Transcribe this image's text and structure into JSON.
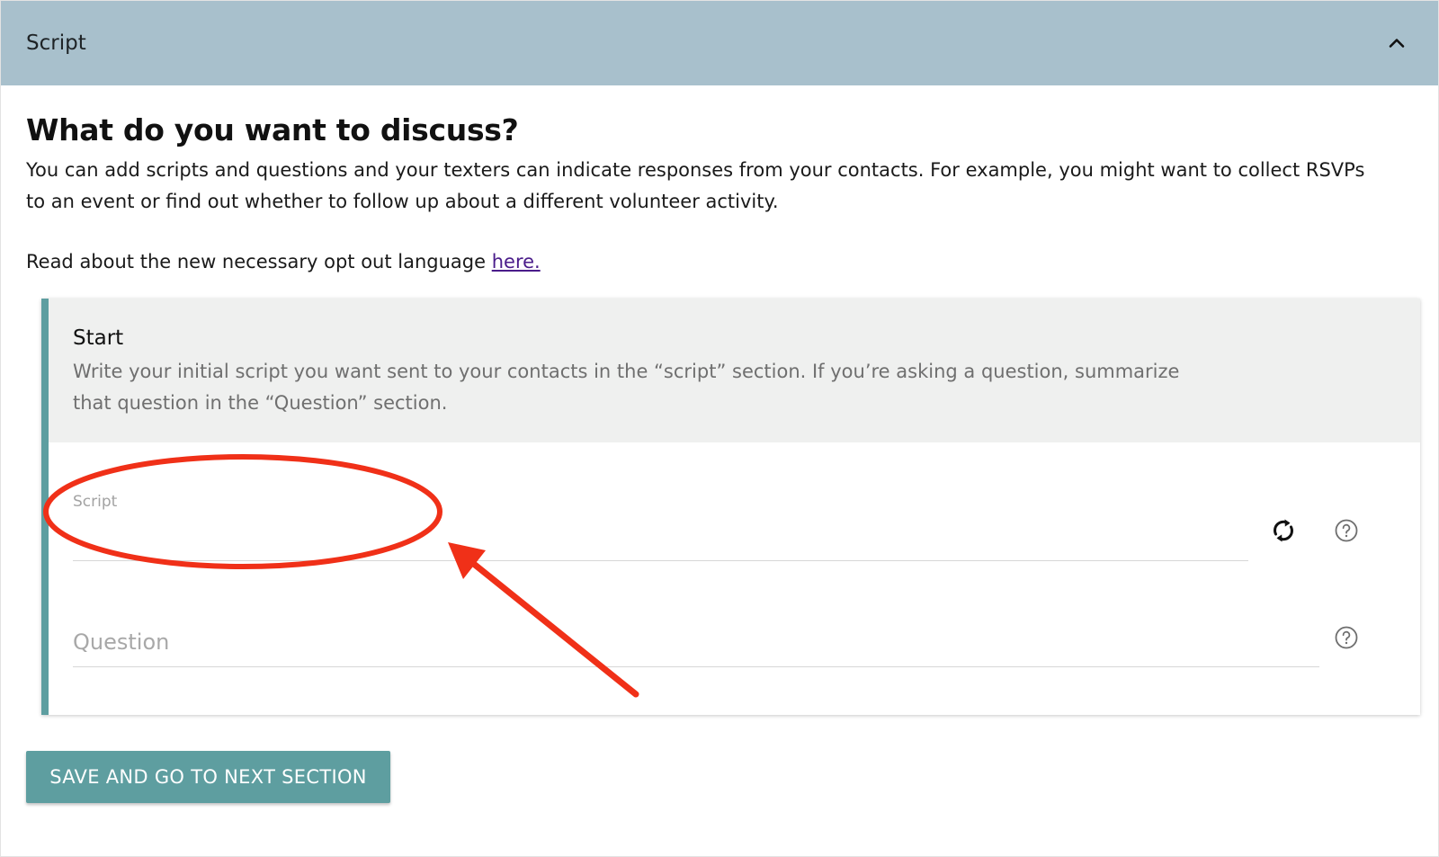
{
  "section": {
    "title": "Script"
  },
  "main": {
    "heading": "What do you want to discuss?",
    "intro": "You can add scripts and questions and your texters can indicate responses from your contacts. For example, you might want to collect RSVPs to an event or find out whether to follow up about a different volunteer activity.",
    "optout_text": "Read about the new necessary opt out language ",
    "optout_link": "here."
  },
  "card": {
    "title": "Start",
    "description": "Write your initial script you want sent to your contacts in the “script” section. If you’re asking a question, summarize that question in the “Question” section.",
    "script_label": "Script",
    "question_placeholder": "Question"
  },
  "actions": {
    "save_label": "SAVE AND GO TO NEXT SECTION"
  },
  "icons": {
    "collapse": "chevron-up-icon",
    "refresh": "refresh-icon",
    "help": "help-circle-icon"
  },
  "colors": {
    "header_bg": "#a8c0cc",
    "accent": "#5e9ea0",
    "annotation": "#f03018",
    "link": "#4a1c8a"
  }
}
